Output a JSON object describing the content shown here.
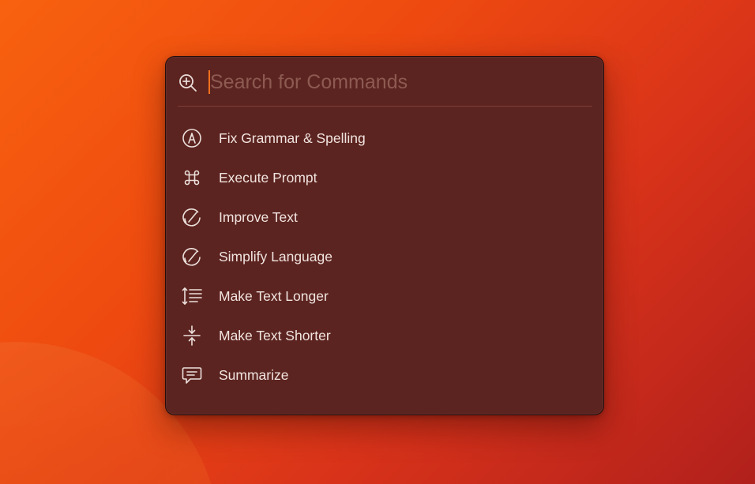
{
  "search": {
    "placeholder": "Search for Commands",
    "value": "",
    "icon": "zoom-in-icon"
  },
  "commands": [
    {
      "label": "Fix Grammar & Spelling",
      "icon": "pen-circle-icon"
    },
    {
      "label": "Execute Prompt",
      "icon": "command-key-icon"
    },
    {
      "label": "Improve Text",
      "icon": "gauge-icon"
    },
    {
      "label": "Simplify Language",
      "icon": "gauge-icon"
    },
    {
      "label": "Make Text Longer",
      "icon": "expand-lines-icon"
    },
    {
      "label": "Make Text Shorter",
      "icon": "compress-arrows-icon"
    },
    {
      "label": "Summarize",
      "icon": "speech-bubble-icon"
    }
  ],
  "colors": {
    "panel_background": "#5c2420",
    "caret": "#f2701f",
    "text": "#f1e4e0",
    "placeholder": "#8d5a52"
  }
}
